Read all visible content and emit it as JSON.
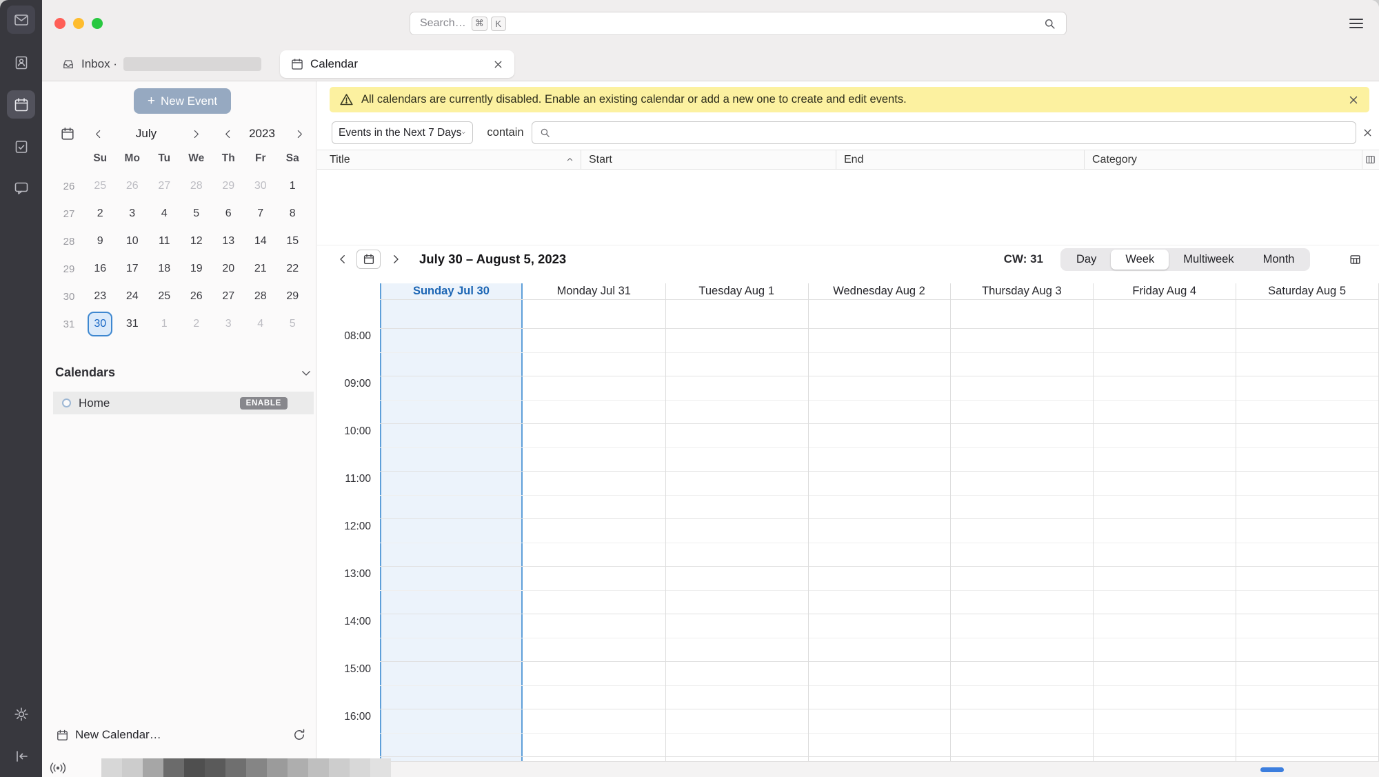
{
  "titlebar": {
    "search_placeholder": "Search…",
    "shortcut_cmd": "⌘",
    "shortcut_k": "K"
  },
  "tabs": {
    "inbox": "Inbox ·",
    "calendar": "Calendar"
  },
  "left_panel": {
    "new_event": "New Event",
    "plus_glyph": "+",
    "mini_calendar": {
      "month": "July",
      "year": "2023",
      "day_headers": [
        "Su",
        "Mo",
        "Tu",
        "We",
        "Th",
        "Fr",
        "Sa"
      ],
      "weeks": [
        {
          "num": "26",
          "days": [
            {
              "d": "25",
              "m": 1
            },
            {
              "d": "26",
              "m": 1
            },
            {
              "d": "27",
              "m": 1
            },
            {
              "d": "28",
              "m": 1
            },
            {
              "d": "29",
              "m": 1
            },
            {
              "d": "30",
              "m": 1
            },
            {
              "d": "1"
            }
          ]
        },
        {
          "num": "27",
          "days": [
            {
              "d": "2"
            },
            {
              "d": "3"
            },
            {
              "d": "4"
            },
            {
              "d": "5"
            },
            {
              "d": "6"
            },
            {
              "d": "7"
            },
            {
              "d": "8"
            }
          ]
        },
        {
          "num": "28",
          "days": [
            {
              "d": "9"
            },
            {
              "d": "10"
            },
            {
              "d": "11"
            },
            {
              "d": "12"
            },
            {
              "d": "13"
            },
            {
              "d": "14"
            },
            {
              "d": "15"
            }
          ]
        },
        {
          "num": "29",
          "days": [
            {
              "d": "16"
            },
            {
              "d": "17"
            },
            {
              "d": "18"
            },
            {
              "d": "19"
            },
            {
              "d": "20"
            },
            {
              "d": "21"
            },
            {
              "d": "22"
            }
          ]
        },
        {
          "num": "30",
          "days": [
            {
              "d": "23"
            },
            {
              "d": "24"
            },
            {
              "d": "25"
            },
            {
              "d": "26"
            },
            {
              "d": "27"
            },
            {
              "d": "28"
            },
            {
              "d": "29"
            }
          ]
        },
        {
          "num": "31",
          "days": [
            {
              "d": "30",
              "sel": true
            },
            {
              "d": "31"
            },
            {
              "d": "1",
              "m": 1
            },
            {
              "d": "2",
              "m": 1
            },
            {
              "d": "3",
              "m": 1
            },
            {
              "d": "4",
              "m": 1
            },
            {
              "d": "5",
              "m": 1
            }
          ]
        }
      ]
    },
    "calendars_header": "Calendars",
    "calendar_list": [
      {
        "name": "Home",
        "badge": "ENABLE"
      }
    ],
    "new_calendar": "New Calendar…"
  },
  "notification": {
    "message": "All calendars are currently disabled. Enable an existing calendar or add a new one to create and edit events."
  },
  "filter": {
    "range_dropdown": "Events in the Next 7 Days",
    "match_label": "contain"
  },
  "event_table": {
    "columns": [
      "Title",
      "Start",
      "End",
      "Category"
    ]
  },
  "calendar_view": {
    "nav_title": "July 30 – August 5, 2023",
    "week_number": "CW: 31",
    "views": [
      "Day",
      "Week",
      "Multiweek",
      "Month"
    ],
    "selected_view": "Week",
    "days": [
      {
        "label": "Sunday Jul 30",
        "today": true
      },
      {
        "label": "Monday Jul 31"
      },
      {
        "label": "Tuesday Aug 1"
      },
      {
        "label": "Wednesday Aug 2"
      },
      {
        "label": "Thursday Aug 3"
      },
      {
        "label": "Friday Aug 4"
      },
      {
        "label": "Saturday Aug 5"
      }
    ],
    "hours": [
      "08:00",
      "09:00",
      "10:00",
      "11:00",
      "12:00",
      "13:00",
      "14:00",
      "15:00",
      "16:00"
    ]
  },
  "colors": {
    "accent_blue": "#1b65b4",
    "warning_bg": "#fcf1a0",
    "today_border": "#5e9fd9",
    "scroll_thumb": "#3c7ede"
  },
  "artifacts": {
    "grayscale_strip": [
      "#d7d7d7",
      "#cccccc",
      "#a6a6a6",
      "#6b6b6b",
      "#4f4f4f",
      "#5a5a5a",
      "#6f6f6f",
      "#858585",
      "#9b9b9b",
      "#aeaeae",
      "#bfbfbf",
      "#cdcdcd",
      "#d8d8d8",
      "#e1e1e1"
    ]
  }
}
